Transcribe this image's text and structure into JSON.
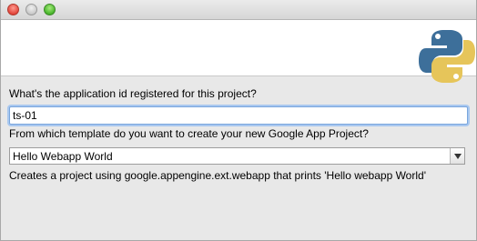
{
  "window": {
    "controls": [
      "close",
      "minimize",
      "zoom"
    ]
  },
  "banner": {
    "logo_icon": "python-logo-icon"
  },
  "form": {
    "app_id_label": "What's the application id registered for this project?",
    "app_id_value": "ts-01",
    "template_label": "From which template do you want to create your new Google App Project?",
    "template_selected": "Hello Webapp World",
    "template_description": "Creates a project using google.appengine.ext.webapp that prints 'Hello webapp World'"
  },
  "colors": {
    "focus_ring": "#a9c8ef",
    "python_blue": "#3d6f9a",
    "python_yellow": "#e6c55a"
  }
}
